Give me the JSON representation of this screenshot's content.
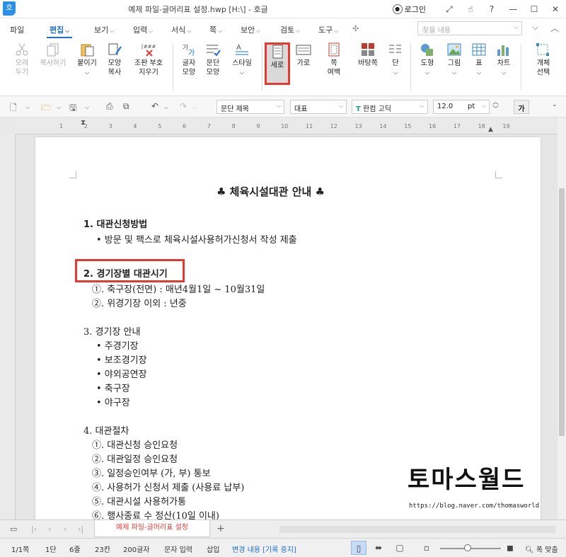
{
  "window": {
    "app_logo": "호",
    "title": "예제 파일-글머리표 설정.hwp [H:\\] - 호글",
    "login_label": "로그인"
  },
  "menu": {
    "items": [
      "파일",
      "편집",
      "보기",
      "입력",
      "서식",
      "쪽",
      "보안",
      "검토",
      "도구"
    ],
    "search_placeholder": "찾을 내용"
  },
  "ribbon": {
    "cut": "오려\n두기",
    "copy": "복사하기",
    "paste": "붙이기",
    "shape_copy": "모양\n복사",
    "code_clear": "조판 부호\n지우기",
    "char_shape": "글자\n모양",
    "para_shape": "문단\n모양",
    "style": "스타일",
    "portrait": "세로",
    "landscape": "가로",
    "page_margin": "쪽\n여백",
    "background_page": "바탕쪽",
    "columns": "단",
    "shape": "도형",
    "picture": "그림",
    "table": "표",
    "chart": "차트",
    "object_select": "개체\n선택"
  },
  "toolbar": {
    "style_dropdown": "문단 제목",
    "style_value": "대표",
    "font": "한컴 고딕",
    "size": "12.0",
    "unit": "pt",
    "font_preview": "가"
  },
  "ruler": {
    "ticks": [
      "1",
      "2",
      "3",
      "4",
      "5",
      "6",
      "7",
      "8",
      "9",
      "10",
      "11",
      "12",
      "13",
      "14",
      "15",
      "16",
      "17",
      "18",
      "19"
    ]
  },
  "document": {
    "title": "♣ 체육시설대관 안내 ♣",
    "s1_heading": "1. 대관신청방법",
    "s1_item": "• 방문 및 팩스로 체육시설사용허가신청서 작성 제출",
    "s2_heading": "2. 경기장별 대관시기",
    "s2_items": [
      "①. 축구장(전면) : 매년4월1일 ~ 10월31일",
      "②. 위경기장 이외 : 년중"
    ],
    "s3_heading": "3. 경기장 안내",
    "s3_items": [
      "• 주경기장",
      "• 보조경기장",
      "• 야외공연장",
      "• 축구장",
      "• 야구장"
    ],
    "s4_heading": "4. 대관절차",
    "s4_items": [
      "①. 대관신청 승인요청",
      "②. 대관일정 승인요청",
      "③. 일정승인여부 (가, 부) 통보",
      "④. 사용허가 신청서 제출 (사용료 납부)",
      "⑤. 대관시설 사용허가통",
      "⑥. 행사종료 수 정산(10일 이내)"
    ],
    "watermark": "토마스월드",
    "watermark_url": "https://blog.naver.com/thomasworld"
  },
  "tabs": {
    "active_tab": "예제 파일-글머리표 설정"
  },
  "status": {
    "page": "1/1쪽",
    "column": "1단",
    "line": "6줄",
    "col_pos": "23칸",
    "chars": "200글자",
    "input_mode": "문자 입력",
    "insert": "삽입",
    "track": "변경 내용 [기록 중지]",
    "fit": "폭 맞춤"
  }
}
